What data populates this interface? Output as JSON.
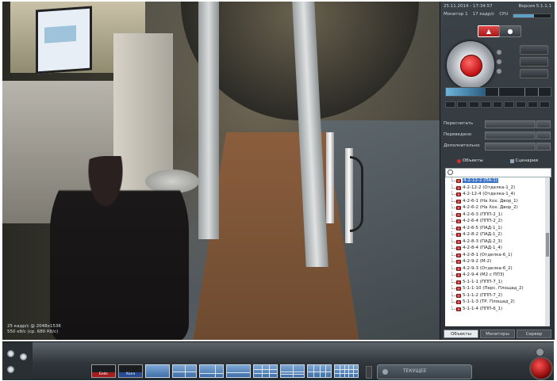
{
  "camera": {
    "info_line1": "25 кадр/с @ 2048x1536",
    "info_line2": "550 кб/с (ср. 680 Кб/с)"
  },
  "panel": {
    "datetime": "25.11.2014 - 17:34:57",
    "version": "Версия 5.1.1.1",
    "monitor_label": "Монитор 1",
    "fps_label": "17 кадр/с",
    "cpu_label": "CPU",
    "cpu_load": 0.55,
    "speed_level": 0.38,
    "controls": [
      {
        "label": "Пересчитать"
      },
      {
        "label": "Переведено"
      },
      {
        "label": "Дополнительно"
      }
    ],
    "object_tab_label": "Объекты",
    "scenario_tab_label": "Сценарии",
    "tree_items": [
      "4-2-12-2 (ПА-1)",
      "4-2-12-2 (Отделка-1_2)",
      "4-2-12-4 (Отделка-1_4)",
      "4-2-6-1 (На Хох. Двор_1)",
      "4-2-6-2 (На Хох. Двор_2)",
      "4-2-6-3 (ППП-2_1)",
      "4-2-6-4 (ППП-2_2)",
      "4-2-6-5 (ПАД-1_1)",
      "4-2-8-2 (ПАД-1_2)",
      "4-2-8-3 (ПАД-2_3)",
      "4-2-8-4 (ПАД-1_4)",
      "4-2-8-1 (Отделка-6_1)",
      "4-2-9-2 (М-2)",
      "4-2-9-3 (Отделка-6_2)",
      "4-2-9-4 (М2 с ППЗ)",
      "5-1-1-1 (ППП-7_1)",
      "5-1-1-10 (Перс. Площад_2)",
      "5-1-1-2 (ППП-7_2)",
      "5-1-1-3 (ТР. Площад_2)",
      "5-1-1-4 (ППП-6_1)"
    ],
    "bottom_tabs": [
      "Объекты",
      "Мониторы",
      "Сервер"
    ]
  },
  "toolbar": {
    "layout_cam1_label": "Бейс",
    "layout_cam2_label": "Холл",
    "status_text": "ТЕКУЩЕЕ"
  },
  "colors": {
    "accent_red": "#c01010",
    "selected_blue": "#3b74c4",
    "layout_blue": "#3f6fa8"
  }
}
